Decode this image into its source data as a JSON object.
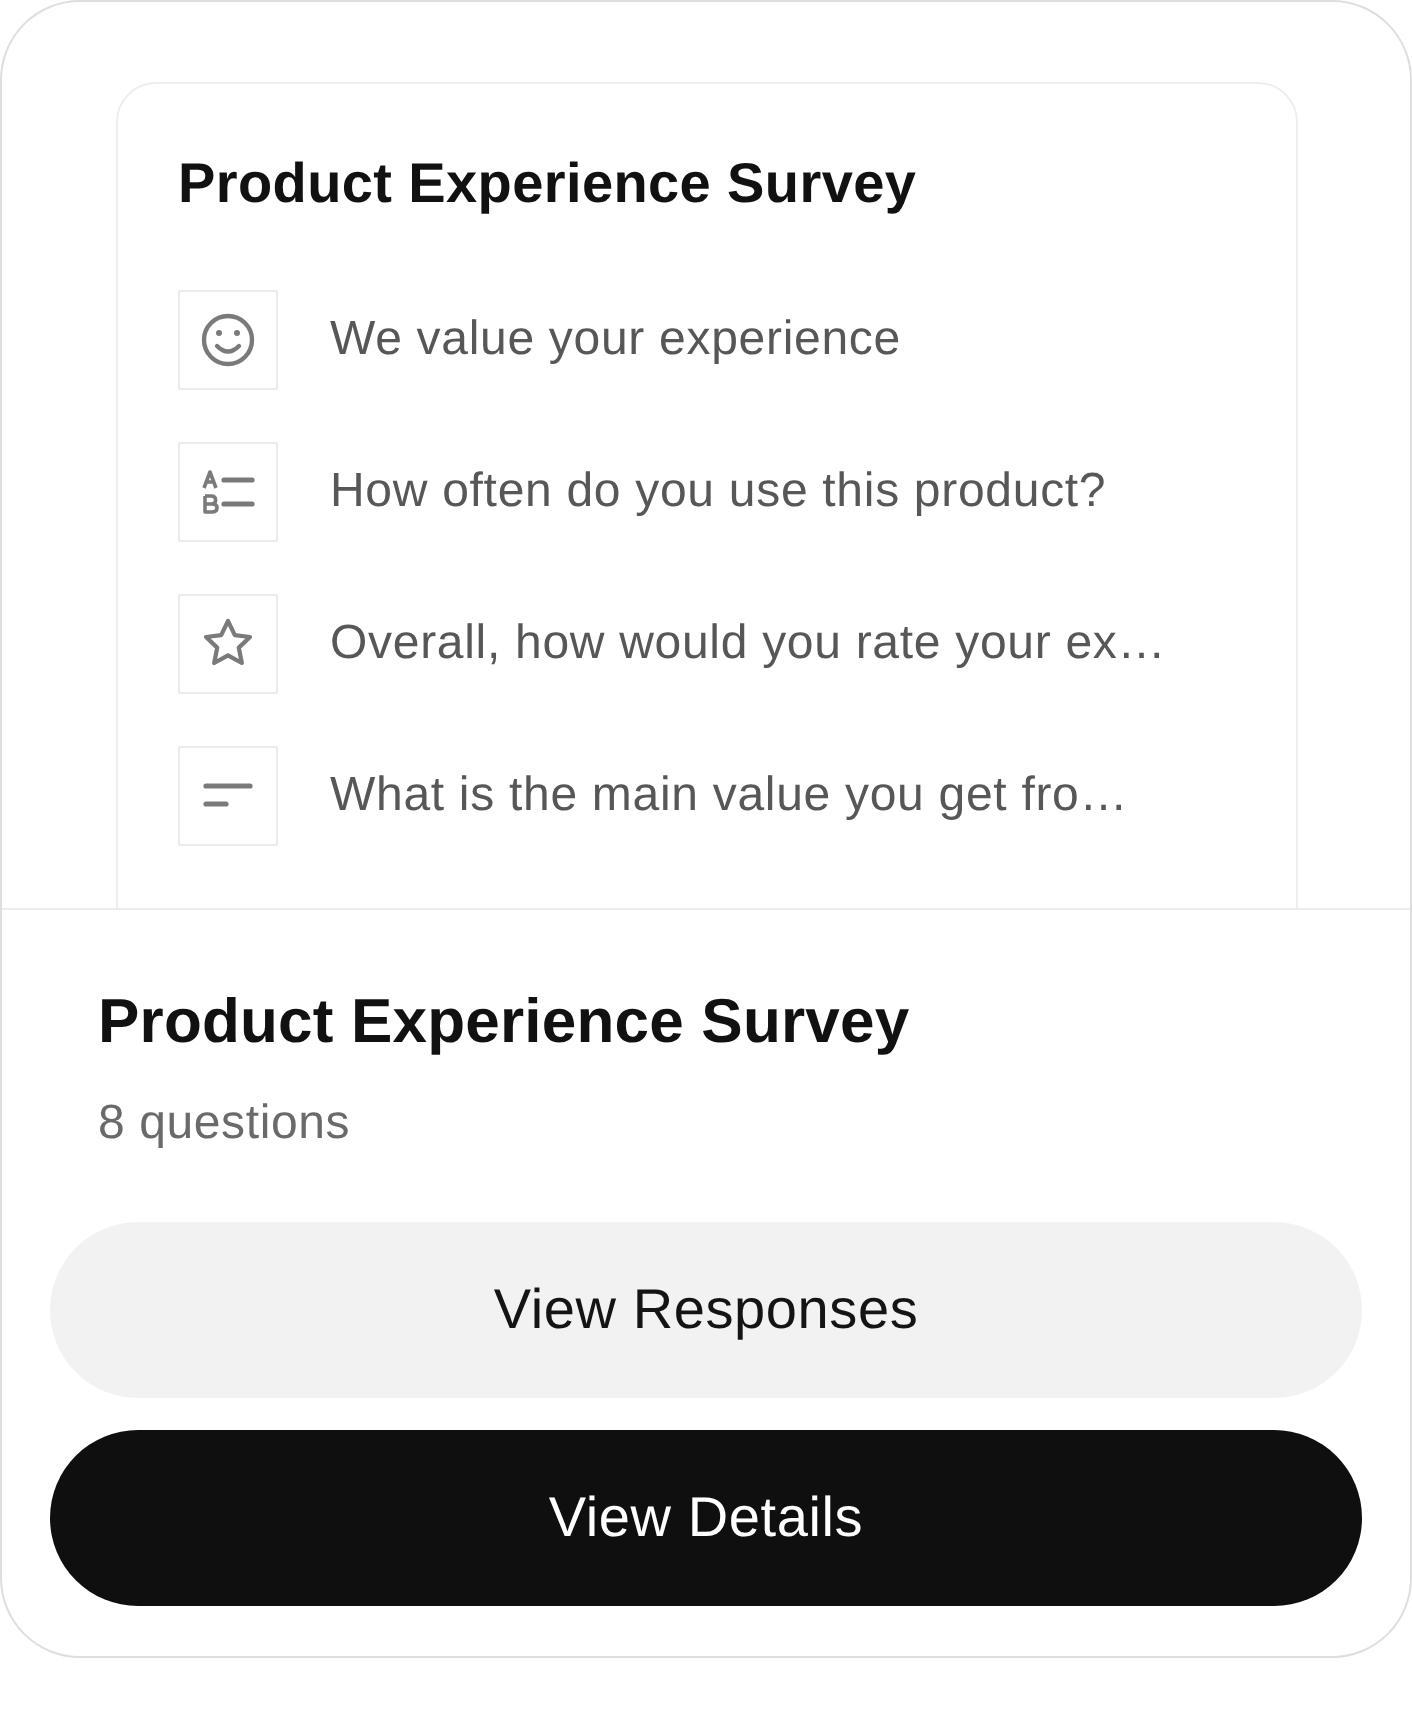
{
  "preview": {
    "title": "Product Experience Survey",
    "questions": [
      {
        "kind": "welcome",
        "text": "We value your experience"
      },
      {
        "kind": "choice",
        "text": "How often do you use this product?"
      },
      {
        "kind": "rating",
        "text": "Overall, how would you rate your ex…"
      },
      {
        "kind": "text",
        "text": "What is the main value you get fro…"
      }
    ]
  },
  "survey": {
    "title": "Product Experience Survey",
    "count": "8 questions"
  },
  "buttons": [
    {
      "kind": "secondary",
      "label": "View Responses"
    },
    {
      "kind": "primary",
      "label": "View Details"
    }
  ]
}
